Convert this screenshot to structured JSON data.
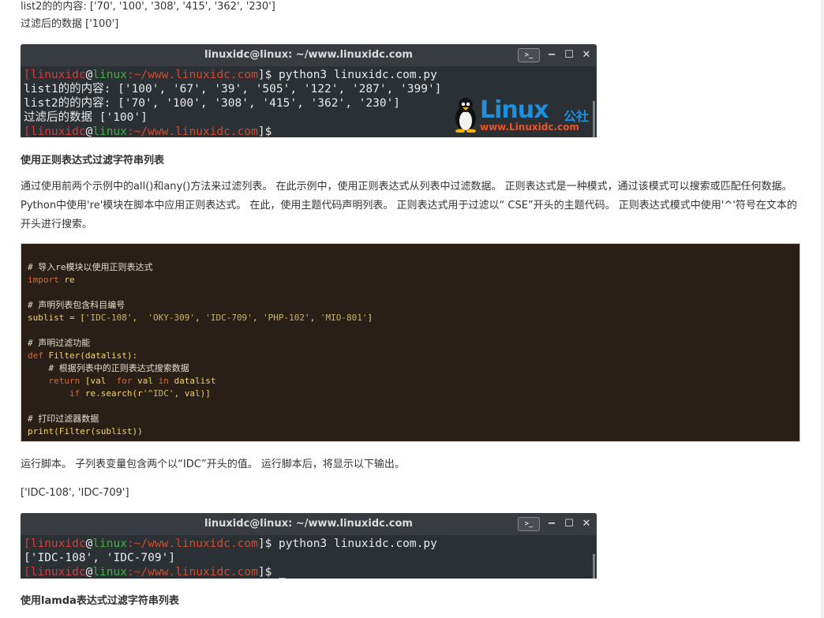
{
  "top_lines": {
    "list2_line": "list2的的内容: ['70', '100', '308', '415', '362', '230']",
    "filtered_line": "过滤后的数据 ['100']"
  },
  "terminal1": {
    "title": "linuxidc@linux: ~/www.linuxidc.com",
    "term_button": ">_",
    "minimize": "−",
    "maximize": "☐",
    "close": "✕",
    "prompt_user": "linuxidc",
    "prompt_at": "@",
    "prompt_host": "linux",
    "prompt_path": ":~/www.linuxidc.com",
    "prompt_dollar": "]$",
    "prompt_open": "[",
    "command": " python3 linuxidc.com.py",
    "out1": "list1的的内容: ['100', '67', '39', '505', '122', '287', '399']",
    "out2": "list2的的内容: ['70', '100', '308', '415', '362', '230']",
    "out3": "过滤后的数据 ['100']",
    "cursor": " _",
    "logo_big": "Linux",
    "logo_cn": "公社",
    "logo_url": "www.Linuxidc.com"
  },
  "section1": {
    "heading": "使用正则表达式过滤字符串列表",
    "paragraph": "通过使用前两个示例中的all()和any()方法来过滤列表。 在此示例中，使用正则表达式从列表中过滤数据。 正则表达式是一种模式，通过该模式可以搜索或匹配任何数据。 Python中使用're'模块在脚本中应用正则表达式。 在此，使用主题代码声明列表。 正则表达式用于过滤以“ CSE”开头的主题代码。 正则表达式模式中使用'^'符号在文本的开头进行搜索。"
  },
  "code": {
    "c1": "# 导入re模块以使用正则表达式",
    "kw_import": "import",
    "id_re": " re",
    "c2": "# 声明列表包含科目编号",
    "sublist_lhs": "sublist = [",
    "s1": "'IDC-108'",
    "sep1": ",  ",
    "s2": "'OKY-309'",
    "sep2": ", ",
    "s3": "'IDC-709'",
    "sep3": ", ",
    "s4": "'PHP-102'",
    "sep4": ", ",
    "s5": "'MIO-801'",
    "close_br": "]",
    "c3": "# 声明过滤功能",
    "kw_def": "def",
    "fn_sig": " Filter(datalist):",
    "c4": "    # 根据列表中的正则表达式搜索数据",
    "kw_return": "    return",
    "ret_a": " [val  ",
    "kw_for": "for",
    "ret_b": " val ",
    "kw_in": "in",
    "ret_c": " datalist",
    "kw_if": "        if",
    "if_a": " re.search(r",
    "if_str": "'^IDC'",
    "if_b": ", val)]",
    "c5": "# 打印过滤器数据",
    "print_line": "print(Filter(sublist))"
  },
  "after_code": {
    "run_text": "运行脚本。 子列表变量包含两个以“IDC”开头的值。 运行脚本后，将显示以下输出。",
    "output_text": "['IDC-108', 'IDC-709']"
  },
  "terminal2": {
    "title": "linuxidc@linux: ~/www.linuxidc.com",
    "term_button": ">_",
    "minimize": "−",
    "maximize": "☐",
    "close": "✕",
    "prompt_user": "linuxidc",
    "prompt_at": "@",
    "prompt_host": "linux",
    "prompt_path": ":~/www.linuxidc.com",
    "prompt_dollar": "]$",
    "prompt_open": "[",
    "command": " python3 linuxidc.com.py",
    "out1": "['IDC-108', 'IDC-709']",
    "cursor": " _"
  },
  "section2": {
    "heading": "使用lamda表达式过滤字符串列表"
  }
}
